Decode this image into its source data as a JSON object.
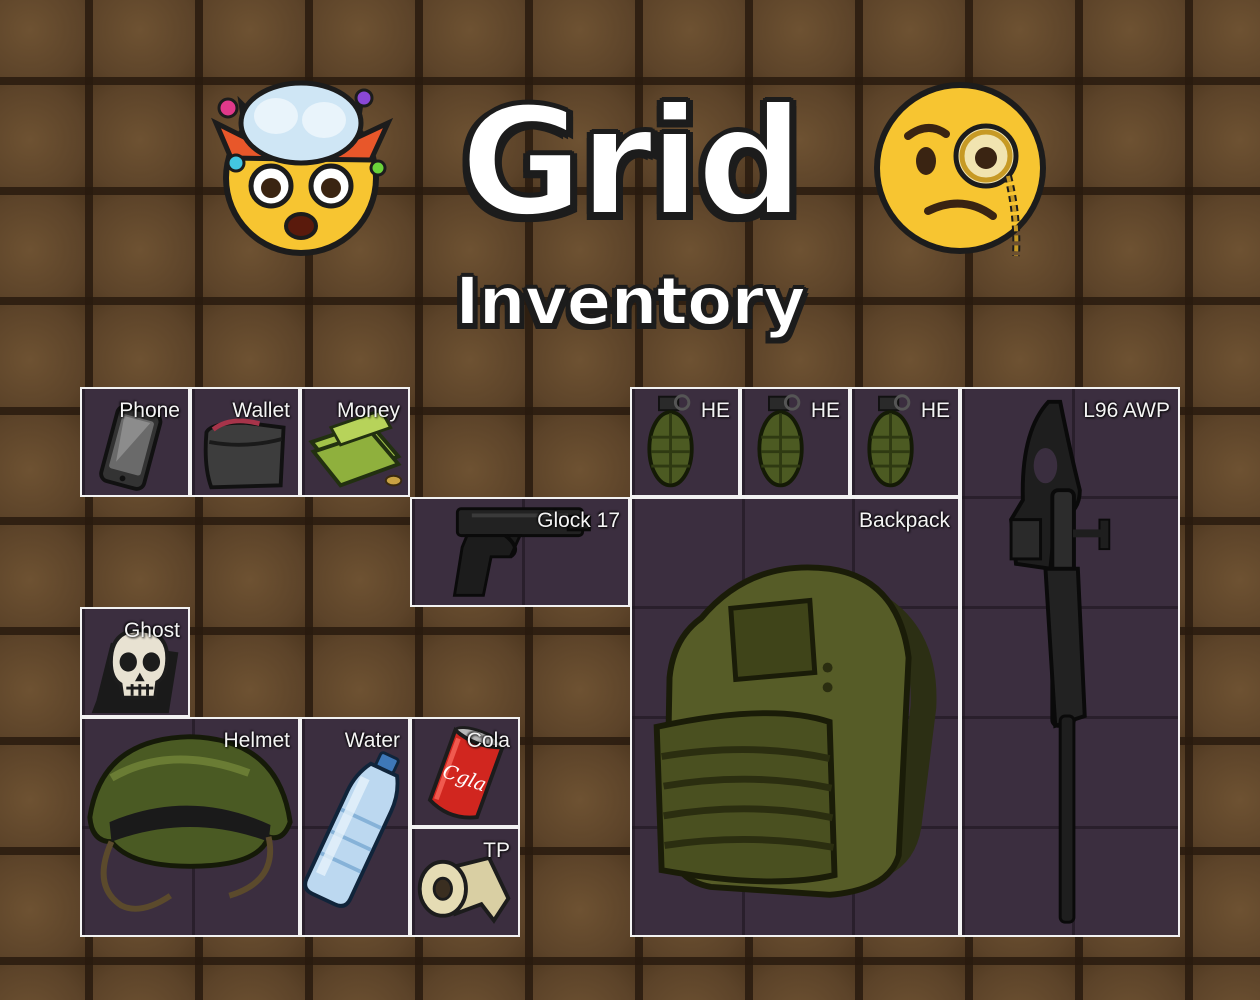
{
  "title": {
    "main": "Grid",
    "sub": "Inventory"
  },
  "emojis": {
    "left": "exploding-head-emoji",
    "right": "monocle-face-emoji"
  },
  "colors": {
    "background": "#5a4127",
    "slot_background": "#3b2e3f",
    "slot_border": "#f2f2f2",
    "title_fill": "#ffffff",
    "title_outline": "#1c1c1c"
  },
  "items": {
    "phone": "Phone",
    "wallet": "Wallet",
    "money": "Money",
    "glock": "Glock 17",
    "ghost": "Ghost",
    "helmet": "Helmet",
    "water": "Water",
    "cola": "Cola",
    "tp": "TP",
    "he1": "HE",
    "he2": "HE",
    "he3": "HE",
    "backpack": "Backpack",
    "awp": "L96 AWP"
  },
  "cola_can_text": "Cgla"
}
